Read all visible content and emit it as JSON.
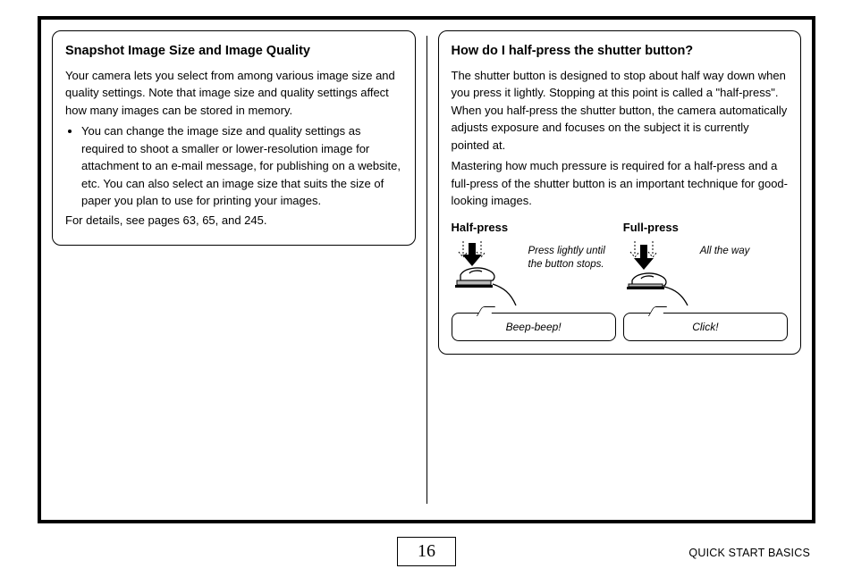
{
  "left": {
    "title": "Snapshot Image Size and Image Quality",
    "intro": "Your camera lets you select from among various image size and quality settings. Note that image size and quality settings affect how many images can be stored in memory.",
    "bullet": "You can change the image size and quality settings as required to shoot a smaller or lower-resolution image for attachment to an e-mail message, for publishing on a website, etc. You can also select an image size that suits the size of paper you plan to use for printing your images.",
    "details": "For details, see pages 63, 65, and 245."
  },
  "right": {
    "title": "How do I half-press the shutter button?",
    "para1": "The shutter button is designed to stop about half way down when you press it lightly. Stopping at this point is called a \"half-press\". When you half-press the shutter button, the camera automatically adjusts exposure and focuses on the subject it is currently pointed at.",
    "para2": "Mastering how much pressure is required for a half-press and a full-press of the shutter button is an important technique for good-looking images.",
    "half": {
      "label": "Half-press",
      "caption": "Press lightly until the button stops.",
      "sound": "Beep-beep!"
    },
    "full": {
      "label": "Full-press",
      "caption": "All the way",
      "sound": "Click!"
    }
  },
  "footer": {
    "page_number": "16",
    "section": "QUICK START BASICS"
  }
}
